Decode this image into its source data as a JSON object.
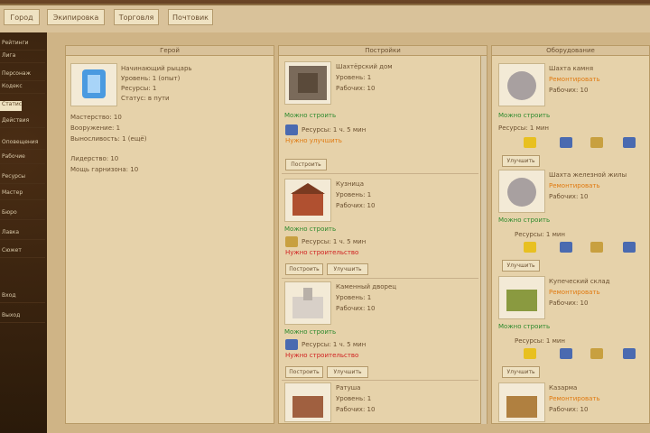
{
  "top_nav": [
    "Город",
    "Экипировка",
    "Торговля",
    "Почтовик"
  ],
  "sidebar_items": [
    "Рейтинги",
    "Лига",
    "Персонаж",
    "Кодекс",
    "Статистика",
    "Действия",
    "Оповещения",
    "Рабочие",
    "Ресурсы",
    "Мастер",
    "Бюро",
    "Лавка",
    "Сюжет",
    "Вход",
    "Выход"
  ],
  "panel_titles": [
    "Герой",
    "Постройки",
    "Оборудование"
  ],
  "hero": {
    "name": "Начинающий рыцарь",
    "lines": [
      "Уровень: 1 (опыт)",
      "Ресурсы: 1",
      "Статус: в пути"
    ],
    "stats": [
      "Мастерство: 10",
      "Вооружение: 1",
      "Выносливость: 1 (ещё)"
    ],
    "extra": [
      "Лидерство: 10",
      "Мощь гарнизона: 10"
    ]
  },
  "buildings": [
    {
      "name": "Шахтёрский дом",
      "lines": [
        "Уровень: 1",
        "Рабочих: 10"
      ],
      "status": "Можно строить",
      "cost": "Ресурсы: 1 ч. 5 мин",
      "warn": "Нужно улучшить",
      "button": "Построить",
      "button2": ""
    },
    {
      "name": "Кузница",
      "lines": [
        "Уровень: 1",
        "Рабочих: 10"
      ],
      "status": "Можно строить",
      "cost": "Ресурсы: 1 ч. 5 мин",
      "warn": "Нужно строительство",
      "button": "Построить",
      "button2": "Улучшить"
    },
    {
      "name": "Каменный дворец",
      "lines": [
        "Уровень: 1",
        "Рабочих: 10"
      ],
      "status": "Можно строить",
      "cost": "Ресурсы: 1 ч. 5 мин",
      "warn": "Нужно строительство",
      "button": "Построить",
      "button2": "Улучшить"
    },
    {
      "name": "Ратуша",
      "lines": [
        "Уровень: 1",
        "Рабочих: 10"
      ],
      "status": "",
      "cost": "",
      "warn": "",
      "button": "",
      "button2": ""
    }
  ],
  "equipment": [
    {
      "name": "Шахта камня",
      "sub": "Ремонтировать",
      "line": "Рабочих: 10",
      "status": "Можно строить",
      "cost": "Ресурсы: 1 мин",
      "button": "Улучшить"
    },
    {
      "name": "Шахта железной жилы",
      "sub": "Ремонтировать",
      "line": "Рабочих: 10",
      "status": "Можно строить",
      "cost": "Ресурсы: 1 мин",
      "button": "Улучшить"
    },
    {
      "name": "Купеческий склад",
      "sub": "Ремонтировать",
      "line": "Рабочих: 10",
      "status": "Можно строить",
      "cost": "Ресурсы: 1 мин",
      "button": "Улучшить"
    },
    {
      "name": "Казарма",
      "sub": "Ремонтировать",
      "line": "Рабочих: 10",
      "status": "",
      "cost": "",
      "button": ""
    }
  ]
}
